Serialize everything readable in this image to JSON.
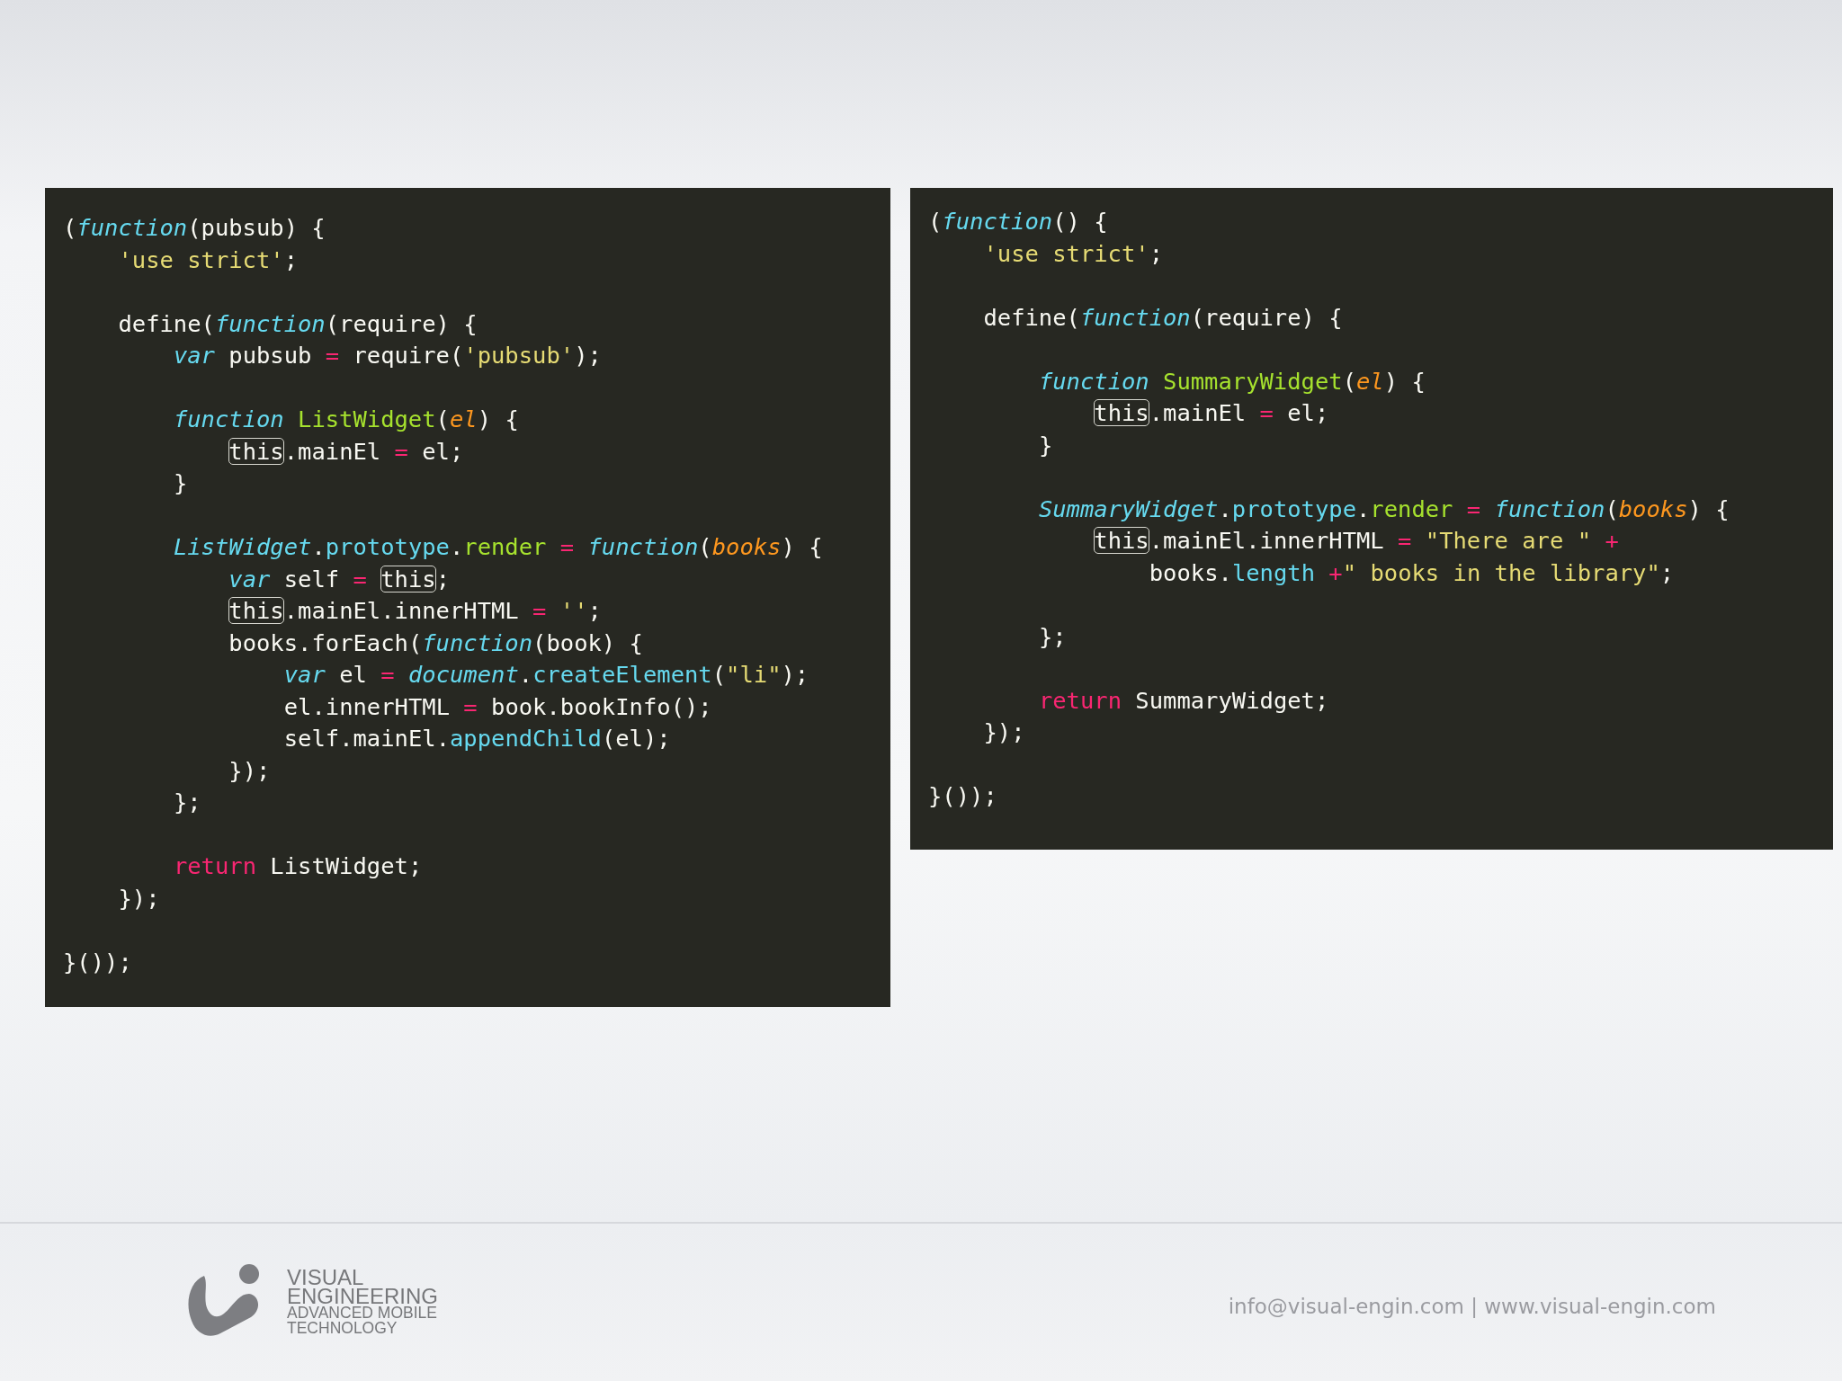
{
  "code_panels": [
    {
      "lines": [
        {
          "kind": "code",
          "tokens": [
            {
              "text": "(",
              "kind": "plain"
            },
            {
              "text": "function",
              "kind": "kw"
            },
            {
              "text": "(pubsub) {",
              "kind": "plain"
            }
          ],
          "children": [
            {
              "kind": "code",
              "tokens": [
                {
                  "text": "'use strict'",
                  "kind": "str"
                },
                {
                  "text": ";",
                  "kind": "plain"
                }
              ]
            },
            {
              "kind": "blank"
            },
            {
              "kind": "code",
              "tokens": [
                {
                  "text": "define(",
                  "kind": "plain"
                },
                {
                  "text": "function",
                  "kind": "kw"
                },
                {
                  "text": "(require) {",
                  "kind": "plain"
                }
              ],
              "children": [
                {
                  "kind": "code",
                  "tokens": [
                    {
                      "text": "var",
                      "kind": "kw"
                    },
                    {
                      "text": " pubsub",
                      "kind": "plain"
                    },
                    {
                      "text": " = ",
                      "kind": "op"
                    },
                    {
                      "text": "require(",
                      "kind": "plain"
                    },
                    {
                      "text": "'pubsub'",
                      "kind": "str"
                    },
                    {
                      "text": ");",
                      "kind": "plain"
                    }
                  ]
                },
                {
                  "kind": "blank"
                },
                {
                  "kind": "code",
                  "tokens": [
                    {
                      "text": "function",
                      "kind": "kw"
                    },
                    {
                      "text": " ListWidget",
                      "kind": "fn"
                    },
                    {
                      "text": "(",
                      "kind": "plain"
                    },
                    {
                      "text": "el",
                      "kind": "param"
                    },
                    {
                      "text": ") {",
                      "kind": "plain"
                    }
                  ],
                  "children": [
                    {
                      "kind": "code",
                      "tokens": [
                        {
                          "text": "this",
                          "kind": "boxed"
                        },
                        {
                          "text": ".mainEl",
                          "kind": "plain"
                        },
                        {
                          "text": " = ",
                          "kind": "op"
                        },
                        {
                          "text": "el;",
                          "kind": "plain"
                        }
                      ]
                    }
                  ]
                },
                {
                  "kind": "code",
                  "tokens": [
                    {
                      "text": "}",
                      "kind": "plain"
                    }
                  ]
                },
                {
                  "kind": "blank"
                },
                {
                  "kind": "code",
                  "tokens": [
                    {
                      "text": "ListWidget",
                      "kind": "kw"
                    },
                    {
                      "text": ".",
                      "kind": "plain"
                    },
                    {
                      "text": "prototype",
                      "kind": "prop"
                    },
                    {
                      "text": ".",
                      "kind": "plain"
                    },
                    {
                      "text": "render",
                      "kind": "fn"
                    },
                    {
                      "text": " = ",
                      "kind": "op"
                    },
                    {
                      "text": "function",
                      "kind": "kw"
                    },
                    {
                      "text": "(",
                      "kind": "plain"
                    },
                    {
                      "text": "books",
                      "kind": "param"
                    },
                    {
                      "text": ") {",
                      "kind": "plain"
                    }
                  ],
                  "children": [
                    {
                      "kind": "code",
                      "tokens": [
                        {
                          "text": "var",
                          "kind": "kw"
                        },
                        {
                          "text": " self",
                          "kind": "plain"
                        },
                        {
                          "text": " = ",
                          "kind": "op"
                        },
                        {
                          "text": "this",
                          "kind": "boxed"
                        },
                        {
                          "text": ";",
                          "kind": "plain"
                        }
                      ]
                    },
                    {
                      "kind": "code",
                      "tokens": [
                        {
                          "text": "this",
                          "kind": "boxed"
                        },
                        {
                          "text": ".mainEl.innerHTML",
                          "kind": "plain"
                        },
                        {
                          "text": " = ",
                          "kind": "op"
                        },
                        {
                          "text": "''",
                          "kind": "str"
                        },
                        {
                          "text": ";",
                          "kind": "plain"
                        }
                      ]
                    },
                    {
                      "kind": "code",
                      "tokens": [
                        {
                          "text": "books.forEach(",
                          "kind": "plain"
                        },
                        {
                          "text": "function",
                          "kind": "kw"
                        },
                        {
                          "text": "(book) {",
                          "kind": "plain"
                        }
                      ],
                      "children": [
                        {
                          "kind": "code",
                          "tokens": [
                            {
                              "text": "var",
                              "kind": "kw"
                            },
                            {
                              "text": " el",
                              "kind": "plain"
                            },
                            {
                              "text": " = ",
                              "kind": "op"
                            },
                            {
                              "text": "document",
                              "kind": "kw"
                            },
                            {
                              "text": ".",
                              "kind": "plain"
                            },
                            {
                              "text": "createElement",
                              "kind": "prop"
                            },
                            {
                              "text": "(",
                              "kind": "plain"
                            },
                            {
                              "text": "\"li\"",
                              "kind": "str"
                            },
                            {
                              "text": ");",
                              "kind": "plain"
                            }
                          ]
                        },
                        {
                          "kind": "code",
                          "tokens": [
                            {
                              "text": "el.innerHTML",
                              "kind": "plain"
                            },
                            {
                              "text": " = ",
                              "kind": "op"
                            },
                            {
                              "text": "book.bookInfo();",
                              "kind": "plain"
                            }
                          ]
                        },
                        {
                          "kind": "code",
                          "tokens": [
                            {
                              "text": "self.mainEl.",
                              "kind": "plain"
                            },
                            {
                              "text": "appendChild",
                              "kind": "prop"
                            },
                            {
                              "text": "(el);",
                              "kind": "plain"
                            }
                          ]
                        }
                      ]
                    },
                    {
                      "kind": "code",
                      "tokens": [
                        {
                          "text": "});",
                          "kind": "plain"
                        }
                      ]
                    }
                  ]
                },
                {
                  "kind": "code",
                  "tokens": [
                    {
                      "text": "};",
                      "kind": "plain"
                    }
                  ]
                },
                {
                  "kind": "blank"
                },
                {
                  "kind": "code",
                  "tokens": [
                    {
                      "text": "return",
                      "kind": "op"
                    },
                    {
                      "text": " ListWidget;",
                      "kind": "plain"
                    }
                  ]
                }
              ]
            },
            {
              "kind": "code",
              "tokens": [
                {
                  "text": "});",
                  "kind": "plain"
                }
              ]
            },
            {
              "kind": "blank"
            }
          ]
        },
        {
          "kind": "code",
          "tokens": [
            {
              "text": "}());",
              "kind": "plain"
            }
          ]
        }
      ]
    },
    {
      "lines": [
        {
          "kind": "code",
          "tokens": [
            {
              "text": "(",
              "kind": "plain"
            },
            {
              "text": "function",
              "kind": "kw"
            },
            {
              "text": "() {",
              "kind": "plain"
            }
          ],
          "children": [
            {
              "kind": "code",
              "tokens": [
                {
                  "text": "'use strict'",
                  "kind": "str"
                },
                {
                  "text": ";",
                  "kind": "plain"
                }
              ]
            },
            {
              "kind": "blank"
            },
            {
              "kind": "code",
              "tokens": [
                {
                  "text": "define(",
                  "kind": "plain"
                },
                {
                  "text": "function",
                  "kind": "kw"
                },
                {
                  "text": "(require) {",
                  "kind": "plain"
                }
              ],
              "children": [
                {
                  "kind": "blank"
                },
                {
                  "kind": "code",
                  "tokens": [
                    {
                      "text": "function",
                      "kind": "kw"
                    },
                    {
                      "text": " SummaryWidget",
                      "kind": "fn"
                    },
                    {
                      "text": "(",
                      "kind": "plain"
                    },
                    {
                      "text": "el",
                      "kind": "param"
                    },
                    {
                      "text": ") {",
                      "kind": "plain"
                    }
                  ],
                  "children": [
                    {
                      "kind": "code",
                      "tokens": [
                        {
                          "text": "this",
                          "kind": "boxed"
                        },
                        {
                          "text": ".mainEl",
                          "kind": "plain"
                        },
                        {
                          "text": " = ",
                          "kind": "op"
                        },
                        {
                          "text": "el;",
                          "kind": "plain"
                        }
                      ]
                    }
                  ]
                },
                {
                  "kind": "code",
                  "tokens": [
                    {
                      "text": "}",
                      "kind": "plain"
                    }
                  ]
                },
                {
                  "kind": "blank"
                },
                {
                  "kind": "code",
                  "tokens": [
                    {
                      "text": "SummaryWidget",
                      "kind": "kw"
                    },
                    {
                      "text": ".",
                      "kind": "plain"
                    },
                    {
                      "text": "prototype",
                      "kind": "prop"
                    },
                    {
                      "text": ".",
                      "kind": "plain"
                    },
                    {
                      "text": "render",
                      "kind": "fn"
                    },
                    {
                      "text": " = ",
                      "kind": "op"
                    },
                    {
                      "text": "function",
                      "kind": "kw"
                    },
                    {
                      "text": "(",
                      "kind": "plain"
                    },
                    {
                      "text": "books",
                      "kind": "param"
                    },
                    {
                      "text": ") {",
                      "kind": "plain"
                    }
                  ],
                  "children": [
                    {
                      "kind": "code",
                      "tokens": [
                        {
                          "text": "this",
                          "kind": "boxed"
                        },
                        {
                          "text": ".mainEl.innerHTML",
                          "kind": "plain"
                        },
                        {
                          "text": " = ",
                          "kind": "op"
                        },
                        {
                          "text": "\"There are \"",
                          "kind": "str"
                        },
                        {
                          "text": " +",
                          "kind": "op"
                        }
                      ],
                      "children": [
                        {
                          "kind": "code",
                          "tokens": [
                            {
                              "text": "books.",
                              "kind": "plain"
                            },
                            {
                              "text": "length",
                              "kind": "prop"
                            },
                            {
                              "text": " +",
                              "kind": "op"
                            },
                            {
                              "text": "\" books in the library\"",
                              "kind": "str"
                            },
                            {
                              "text": ";",
                              "kind": "plain"
                            }
                          ]
                        }
                      ]
                    },
                    {
                      "kind": "blank"
                    }
                  ]
                },
                {
                  "kind": "code",
                  "tokens": [
                    {
                      "text": "};",
                      "kind": "plain"
                    }
                  ]
                },
                {
                  "kind": "blank"
                },
                {
                  "kind": "code",
                  "tokens": [
                    {
                      "text": "return",
                      "kind": "op"
                    },
                    {
                      "text": " SummaryWidget;",
                      "kind": "plain"
                    }
                  ]
                }
              ]
            },
            {
              "kind": "code",
              "tokens": [
                {
                  "text": "});",
                  "kind": "plain"
                }
              ]
            },
            {
              "kind": "blank"
            }
          ]
        },
        {
          "kind": "code",
          "tokens": [
            {
              "text": "}());",
              "kind": "plain"
            }
          ]
        }
      ]
    }
  ],
  "footer": {
    "brand_name_lines": [
      "VISUAL",
      "ENGINEERING"
    ],
    "tagline_lines": [
      "ADVANCED MOBILE",
      "TECHNOLOGY"
    ],
    "contact": "info@visual-engin.com | www.visual-engin.com"
  }
}
